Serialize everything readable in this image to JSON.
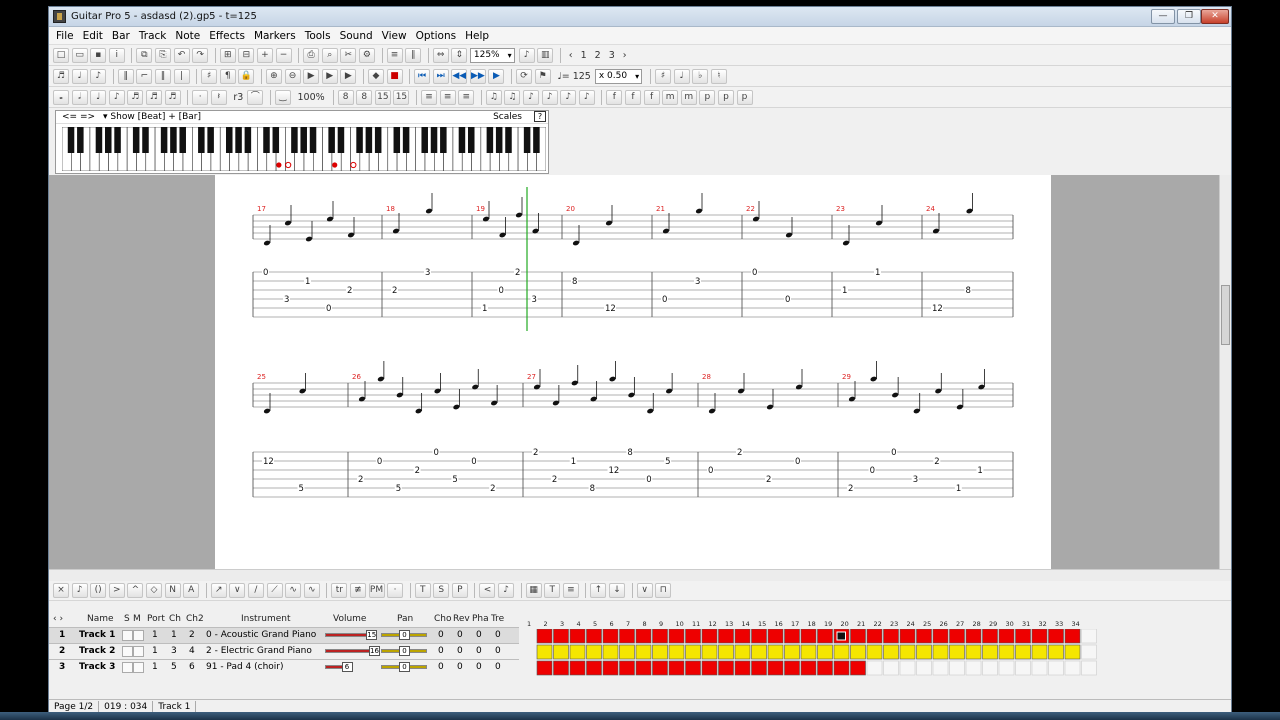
{
  "window": {
    "title": "Guitar Pro 5 - asdasd (2).gp5 - t=125"
  },
  "menu": [
    "File",
    "Edit",
    "Bar",
    "Track",
    "Note",
    "Effects",
    "Markers",
    "Tools",
    "Sound",
    "View",
    "Options",
    "Help"
  ],
  "toolbar1": {
    "zoom": "125%",
    "pages": [
      "1",
      "2",
      "3"
    ]
  },
  "toolbar2": {
    "tempo": "♩= 125",
    "speed": "x 0.50"
  },
  "toolbar3": {
    "percent": "100%",
    "triplet": "r3"
  },
  "keyboard": {
    "nav": "<= =>",
    "show": "Show [Beat] + [Bar]",
    "scales": "Scales",
    "help": "?"
  },
  "score": {
    "row1": {
      "bars": [
        "17",
        "18",
        "19",
        "20",
        "21",
        "22",
        "23",
        "24"
      ],
      "tab": [
        [
          "0",
          "3",
          "1",
          "0",
          "2"
        ],
        [
          "2",
          "3"
        ],
        [
          "1",
          "0",
          "2",
          "3"
        ],
        [
          "8",
          "12"
        ],
        [
          "0",
          "3"
        ],
        [
          "0",
          "0"
        ],
        [
          "1",
          "1"
        ],
        [
          "12",
          "8"
        ]
      ]
    },
    "row2": {
      "bars": [
        "25",
        "26",
        "27",
        "28",
        "29"
      ],
      "tab": [
        [
          "12",
          "5"
        ],
        [
          "2",
          "0",
          "5",
          "2",
          "0",
          "5",
          "0",
          "2"
        ],
        [
          "2",
          "2",
          "1",
          "8",
          "12",
          "8",
          "0",
          "5"
        ],
        [
          "0",
          "2",
          "2",
          "0"
        ],
        [
          "2",
          "0",
          "0",
          "3",
          "2",
          "1",
          "1"
        ]
      ]
    }
  },
  "tracks": {
    "headers": [
      "Name",
      "S",
      "M",
      "Port",
      "Ch",
      "Ch2",
      "Instrument",
      "Volume",
      "Pan",
      "Cho",
      "Rev",
      "Pha",
      "Tre"
    ],
    "rows": [
      {
        "num": "1",
        "name": "Track 1",
        "port": "1",
        "ch": "1",
        "ch2": "2",
        "instrument": "0 - Acoustic Grand Piano",
        "volume": "15",
        "pan": "0",
        "fx": [
          "0",
          "0",
          "0",
          "0"
        ]
      },
      {
        "num": "2",
        "name": "Track 2",
        "port": "1",
        "ch": "3",
        "ch2": "4",
        "instrument": "2 - Electric Grand Piano",
        "volume": "16",
        "pan": "0",
        "fx": [
          "0",
          "0",
          "0",
          "0"
        ]
      },
      {
        "num": "3",
        "name": "Track 3",
        "port": "1",
        "ch": "5",
        "ch2": "6",
        "instrument": "91 - Pad 4 (choir)",
        "volume": "6",
        "pan": "0",
        "fx": [
          "0",
          "0",
          "0",
          "0"
        ]
      }
    ]
  },
  "sequencer": {
    "columns": [
      "1",
      "2",
      "3",
      "4",
      "5",
      "6",
      "7",
      "8",
      "9",
      "10",
      "11",
      "12",
      "13",
      "14",
      "15",
      "16",
      "17",
      "18",
      "19",
      "20",
      "21",
      "22",
      "23",
      "24",
      "25",
      "26",
      "27",
      "28",
      "29",
      "30",
      "31",
      "32",
      "33",
      "34"
    ],
    "track_fills": [
      33,
      33,
      20
    ],
    "current_bar": 19,
    "colors": {
      "track1": "#ee0000",
      "track2": "#f5e600",
      "track3": "#ee0000",
      "empty": "#f6f6f6"
    }
  },
  "status": {
    "page": "Page 1/2",
    "position": "019 : 034",
    "track": "Track 1"
  }
}
